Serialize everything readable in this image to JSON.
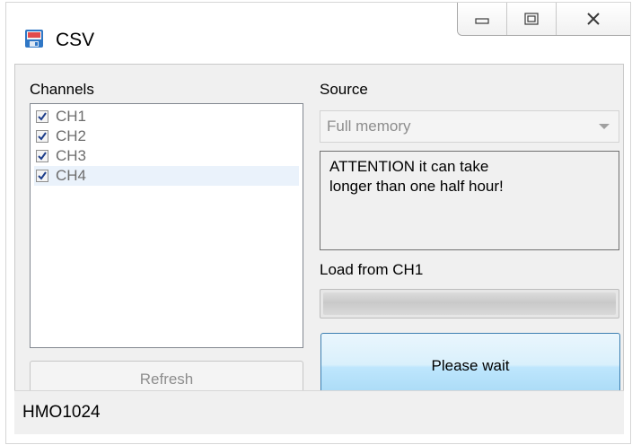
{
  "window": {
    "title": "CSV",
    "app_icon": "csv-file-icon",
    "caption_icons": [
      "minimize-icon",
      "restore-icon",
      "close-icon"
    ]
  },
  "channels": {
    "label": "Channels",
    "items": [
      {
        "label": "CH1",
        "checked": true
      },
      {
        "label": "CH2",
        "checked": true
      },
      {
        "label": "CH3",
        "checked": true
      },
      {
        "label": "CH4",
        "checked": true,
        "selected": true
      }
    ],
    "refresh_label": "Refresh"
  },
  "source": {
    "label": "Source",
    "selected": "Full memory",
    "attention_line1": "ATTENTION it can take",
    "attention_line2": "longer than one half hour!"
  },
  "load": {
    "label": "Load from CH1",
    "progress_fraction": 0.0
  },
  "action": {
    "button_label": "Please wait"
  },
  "status": {
    "device": "HMO1024"
  },
  "colors": {
    "button_border": "#3c7fb1",
    "button_fill": "#bee6fd",
    "window_bg": "#f0f0f0"
  }
}
